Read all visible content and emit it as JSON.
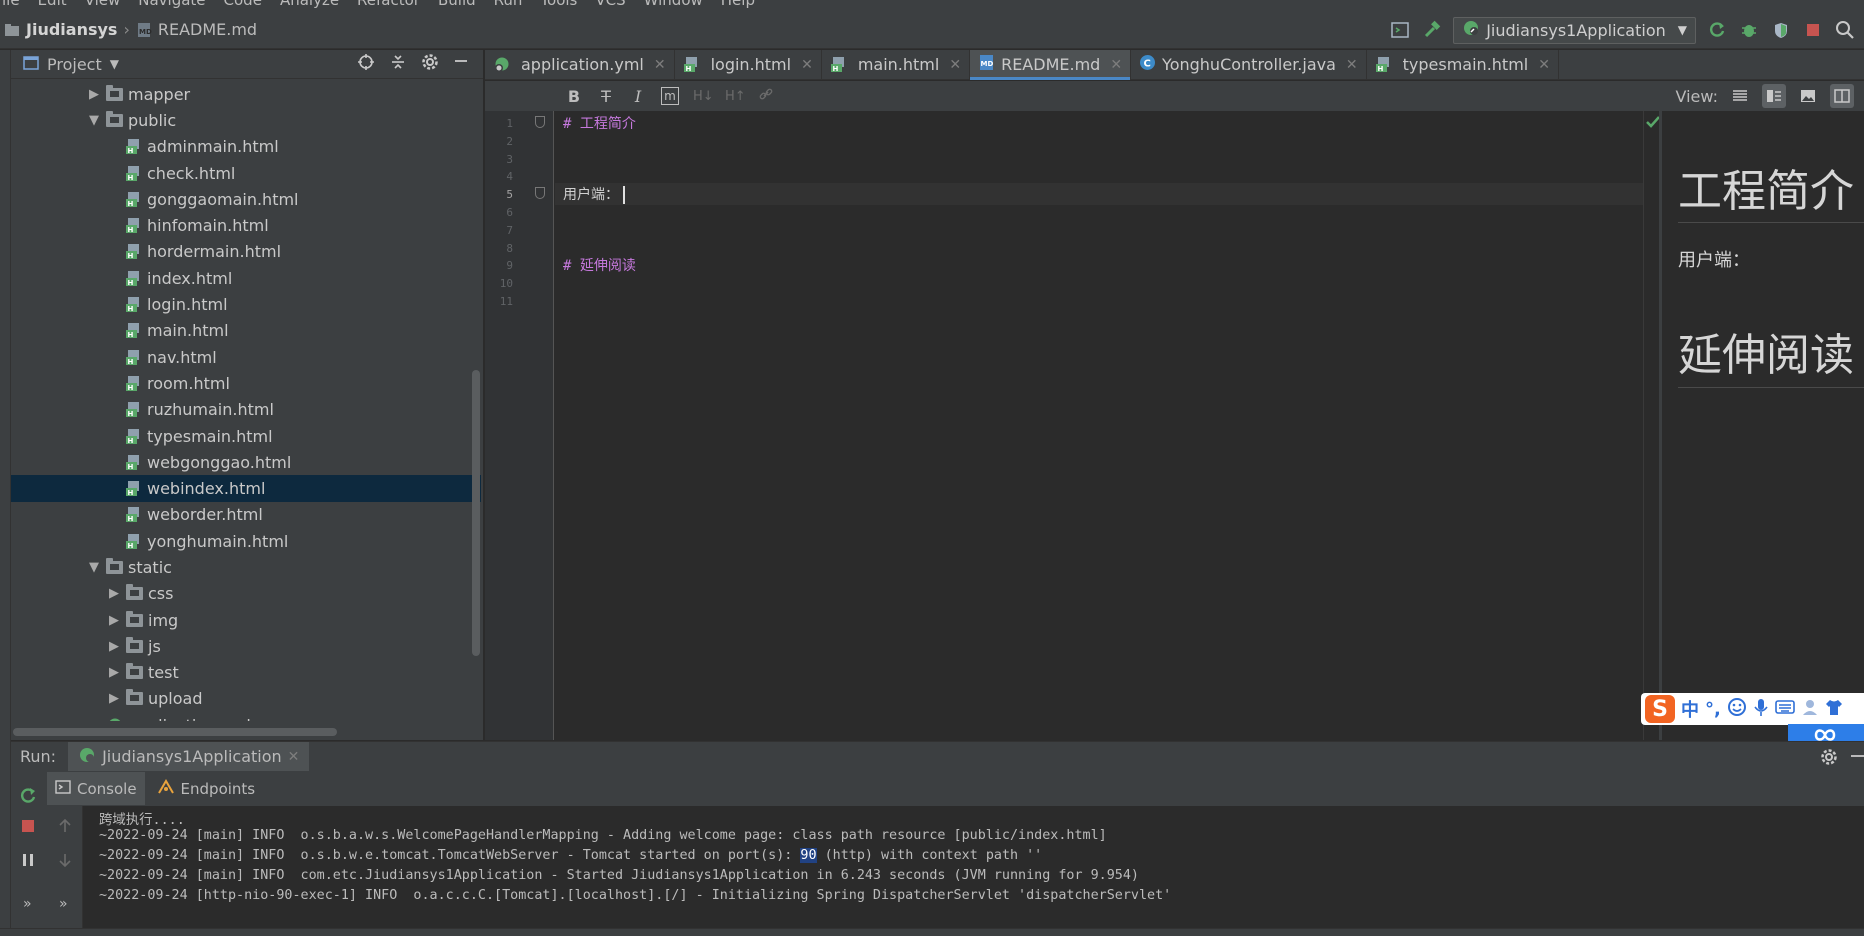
{
  "menubar": {
    "items": [
      "ile",
      "Edit",
      "View",
      "Navigate",
      "Code",
      "Analyze",
      "Refactor",
      "Build",
      "Run",
      "Tools",
      "VCS",
      "Window",
      "Help"
    ]
  },
  "breadcrumb": {
    "project": "Jiudiansys",
    "file": "README.md"
  },
  "run_config": {
    "name": "Jiudiansys1Application"
  },
  "project_panel": {
    "title": "Project",
    "tree": [
      {
        "label": "mapper",
        "type": "folder",
        "level": 1,
        "expanded": false
      },
      {
        "label": "public",
        "type": "folder",
        "level": 1,
        "expanded": true
      },
      {
        "label": "adminmain.html",
        "type": "html",
        "level": 2
      },
      {
        "label": "check.html",
        "type": "html",
        "level": 2
      },
      {
        "label": "gonggaomain.html",
        "type": "html",
        "level": 2
      },
      {
        "label": "hinfomain.html",
        "type": "html",
        "level": 2
      },
      {
        "label": "hordermain.html",
        "type": "html",
        "level": 2
      },
      {
        "label": "index.html",
        "type": "html",
        "level": 2
      },
      {
        "label": "login.html",
        "type": "html",
        "level": 2
      },
      {
        "label": "main.html",
        "type": "html",
        "level": 2
      },
      {
        "label": "nav.html",
        "type": "html",
        "level": 2
      },
      {
        "label": "room.html",
        "type": "html",
        "level": 2
      },
      {
        "label": "ruzhumain.html",
        "type": "html",
        "level": 2
      },
      {
        "label": "typesmain.html",
        "type": "html",
        "level": 2
      },
      {
        "label": "webgonggao.html",
        "type": "html",
        "level": 2
      },
      {
        "label": "webindex.html",
        "type": "html",
        "level": 2,
        "selected": true
      },
      {
        "label": "weborder.html",
        "type": "html",
        "level": 2
      },
      {
        "label": "yonghumain.html",
        "type": "html",
        "level": 2
      },
      {
        "label": "static",
        "type": "folder",
        "level": 1,
        "expanded": true
      },
      {
        "label": "css",
        "type": "folder",
        "level": 2,
        "expanded": false
      },
      {
        "label": "img",
        "type": "folder",
        "level": 2,
        "expanded": false
      },
      {
        "label": "js",
        "type": "folder",
        "level": 2,
        "expanded": false
      },
      {
        "label": "test",
        "type": "folder",
        "level": 2,
        "expanded": false
      },
      {
        "label": "upload",
        "type": "folder",
        "level": 2,
        "expanded": false
      },
      {
        "label": "application.yml",
        "type": "yml",
        "level": 1
      }
    ]
  },
  "editor_tabs": [
    {
      "label": "application.yml",
      "type": "yml"
    },
    {
      "label": "login.html",
      "type": "html"
    },
    {
      "label": "main.html",
      "type": "html"
    },
    {
      "label": "README.md",
      "type": "md",
      "active": true
    },
    {
      "label": "YonghuController.java",
      "type": "java"
    },
    {
      "label": "typesmain.html",
      "type": "html"
    }
  ],
  "md_toolbar": {
    "view_label": "View:"
  },
  "editor": {
    "line_numbers": [
      "1",
      "2",
      "3",
      "4",
      "5",
      "6",
      "7",
      "8",
      "9",
      "10",
      "11"
    ],
    "current_line": 5,
    "lines": [
      {
        "line": 1,
        "text": "# 工程简介",
        "kind": "heading"
      },
      {
        "line": 5,
        "text": "用户端：",
        "kind": "plain"
      },
      {
        "line": 9,
        "text": "# 延伸阅读",
        "kind": "heading"
      }
    ]
  },
  "preview": {
    "h1_first": "工程简介",
    "paragraph": "用户端：",
    "h1_second": "延伸阅读"
  },
  "ime": {
    "logo": "S",
    "mode": "中",
    "punct": "°,"
  },
  "run_panel": {
    "label": "Run:",
    "tab": "Jiudiansys1Application",
    "sub_tabs": [
      "Console",
      "Endpoints"
    ],
    "console_lines": [
      "跨域执行....",
      "~2022-09-24 [main] INFO  o.s.b.a.w.s.WelcomePageHandlerMapping - Adding welcome page: class path resource [public/index.html]",
      "~2022-09-24 [main] INFO  o.s.b.w.e.tomcat.TomcatWebServer - Tomcat started on port(s): ",
      "~2022-09-24 [main] INFO  com.etc.Jiudiansys1Application - Started Jiudiansys1Application in 6.243 seconds (JVM running for 9.954)",
      "~2022-09-24 [http-nio-90-exec-1] INFO  o.a.c.c.C.[Tomcat].[localhost].[/] - Initializing Spring DispatcherServlet 'dispatcherServlet'"
    ],
    "port_value": "90",
    "port_suffix": " (http) with context path ''"
  },
  "colors": {
    "selection": "#0d293e",
    "accent": "#4a88c7",
    "heading": "#c679dd",
    "run_green": "#59a869",
    "stop_red": "#c75450"
  }
}
